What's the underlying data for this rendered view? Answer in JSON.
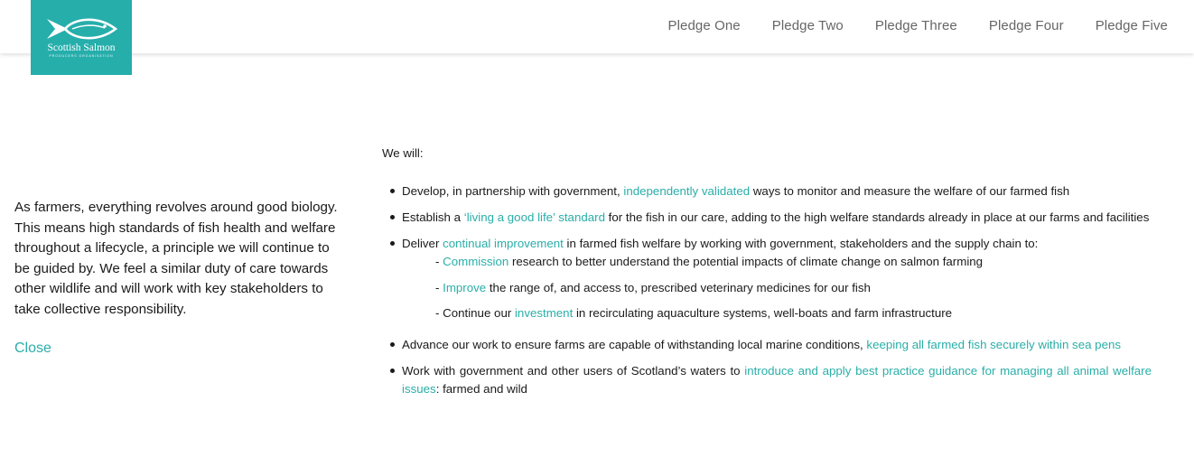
{
  "logo": {
    "name": "Scottish Salmon",
    "subtitle": "PRODUCERS ORGANISATION",
    "color": "#26aeab"
  },
  "nav": {
    "items": [
      {
        "label": "Pledge One"
      },
      {
        "label": "Pledge Two"
      },
      {
        "label": "Pledge Three"
      },
      {
        "label": "Pledge Four"
      },
      {
        "label": "Pledge Five"
      }
    ]
  },
  "intro": {
    "text": "As farmers, everything revolves around good biology. This means high standards of fish health and welfare throughout a lifecycle, a principle we will continue to be guided by. We feel a similar duty of care towards other wildlife and will work with key stakeholders to take collective responsibility.",
    "close_label": "Close"
  },
  "content": {
    "lead": "We will:",
    "items": [
      {
        "before": "Develop, in partnership with government, ",
        "highlight": "independently validated",
        "after": " ways to monitor and measure the welfare of our farmed fish"
      },
      {
        "before": "Establish a ",
        "highlight": "‘living a good life’ standard",
        "after": " for the fish in our care, adding to the high welfare standards already in place at our farms and facilities"
      },
      {
        "before": "Deliver ",
        "highlight": "continual improvement",
        "after": " in farmed fish welfare by working with government, stakeholders and the supply chain to:",
        "subs": [
          {
            "before": "- ",
            "highlight": "Commission",
            "after": " research to better understand the potential impacts of climate change on salmon farming"
          },
          {
            "before": "- ",
            "highlight": "Improve",
            "after": " the range of, and access to, prescribed veterinary medicines for our fish"
          },
          {
            "before": "- Continue our ",
            "highlight": "investment",
            "after": " in recirculating aquaculture systems, well-boats and farm infrastructure"
          }
        ]
      },
      {
        "before": "Advance our work to ensure farms are capable of withstanding local marine conditions, ",
        "highlight": "keeping all farmed fish securely within sea pens",
        "after": ""
      },
      {
        "before": "Work with government and other users of Scotland’s waters to ",
        "highlight": "introduce and apply best practice guidance for managing all animal welfare issues",
        "after": ": farmed and wild"
      }
    ]
  },
  "colors": {
    "accent": "#2aaea8",
    "nav_text": "#666666",
    "body_text": "#1a1a1a"
  }
}
